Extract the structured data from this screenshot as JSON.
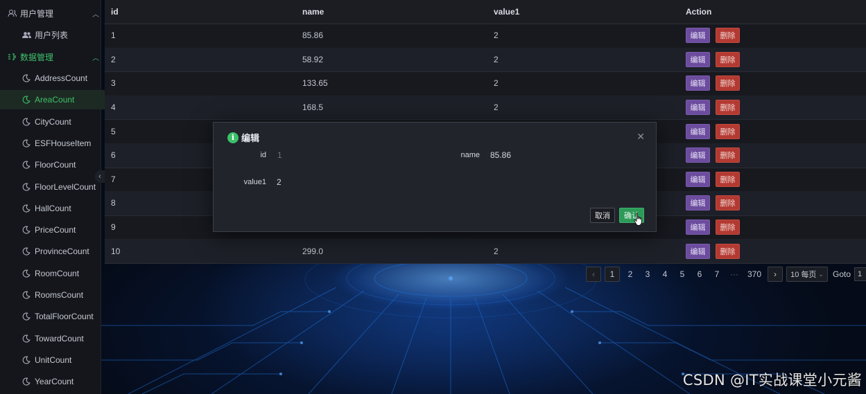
{
  "sidebar": {
    "groups": [
      {
        "label": "用户管理",
        "icon": "users-icon",
        "expanded": true,
        "items": [
          {
            "label": "用户列表",
            "icon": "user-group-icon"
          }
        ]
      },
      {
        "label": "数据管理",
        "icon": "data-icon",
        "expanded": true
      }
    ],
    "data_items": [
      {
        "label": "AddressCount",
        "active": false
      },
      {
        "label": "AreaCount",
        "active": true
      },
      {
        "label": "CityCount",
        "active": false
      },
      {
        "label": "ESFHouseItem",
        "active": false
      },
      {
        "label": "FloorCount",
        "active": false
      },
      {
        "label": "FloorLevelCount",
        "active": false
      },
      {
        "label": "HallCount",
        "active": false
      },
      {
        "label": "PriceCount",
        "active": false
      },
      {
        "label": "ProvinceCount",
        "active": false
      },
      {
        "label": "RoomCount",
        "active": false
      },
      {
        "label": "RoomsCount",
        "active": false
      },
      {
        "label": "TotalFloorCount",
        "active": false
      },
      {
        "label": "TowardCount",
        "active": false
      },
      {
        "label": "UnitCount",
        "active": false
      },
      {
        "label": "YearCount",
        "active": false
      }
    ],
    "item_icon": "moon-icon",
    "accent_color": "#3fc16a"
  },
  "table": {
    "headers": {
      "id": "id",
      "name": "name",
      "value1": "value1",
      "action": "Action"
    },
    "rows": [
      {
        "id": "1",
        "name": "85.86",
        "value1": "2"
      },
      {
        "id": "2",
        "name": "58.92",
        "value1": "2"
      },
      {
        "id": "3",
        "name": "133.65",
        "value1": "2"
      },
      {
        "id": "4",
        "name": "168.5",
        "value1": "2"
      },
      {
        "id": "5",
        "name": "",
        "value1": ""
      },
      {
        "id": "6",
        "name": "",
        "value1": ""
      },
      {
        "id": "7",
        "name": "",
        "value1": ""
      },
      {
        "id": "8",
        "name": "",
        "value1": ""
      },
      {
        "id": "9",
        "name": "",
        "value1": ""
      },
      {
        "id": "10",
        "name": "299.0",
        "value1": "2"
      }
    ],
    "edit_label": "编辑",
    "delete_label": "删除",
    "edit_color": "#6c4c9e",
    "delete_color": "#b33a32"
  },
  "pagination": {
    "prev": "‹",
    "pages": [
      "1",
      "2",
      "3",
      "4",
      "5",
      "6",
      "7"
    ],
    "ellipsis": "···",
    "last_page": "370",
    "next": "›",
    "page_size": "10 每页",
    "goto_label": "Goto",
    "goto_value": "1",
    "current_page": "1"
  },
  "dialog": {
    "title": "编辑",
    "fields": {
      "id_label": "id",
      "id_value": "1",
      "name_label": "name",
      "name_value": "85.86",
      "value1_label": "value1",
      "value1_value": "2"
    },
    "cancel_label": "取消",
    "ok_label": "确认",
    "close_icon": "close-icon",
    "ok_color": "#2e9a59"
  },
  "watermark": "CSDN @IT实战课堂小元酱"
}
